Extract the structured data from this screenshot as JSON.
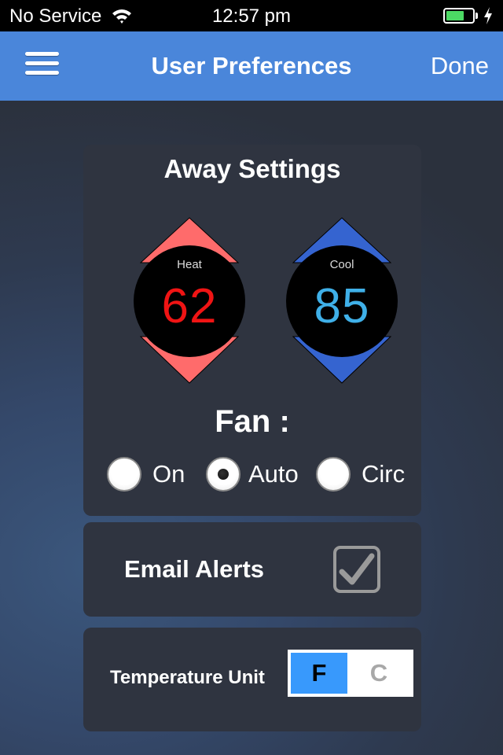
{
  "status_bar": {
    "carrier": "No Service",
    "time": "12:57 pm",
    "battery_level": 0.7,
    "battery_color": "#4cd964",
    "icons": [
      "wifi-icon",
      "battery-icon",
      "charging-bolt-icon"
    ]
  },
  "nav": {
    "menu_icon": "hamburger-menu-icon",
    "title": "User Preferences",
    "done_label": "Done",
    "background": "#4a86da"
  },
  "away_settings": {
    "title": "Away Settings",
    "heat": {
      "label": "Heat",
      "value": "62",
      "color": "#f01414",
      "arrow_color": "#ff6b6b"
    },
    "cool": {
      "label": "Cool",
      "value": "85",
      "color": "#3fb0e8",
      "arrow_color": "#3564d0"
    },
    "fan": {
      "title": "Fan :",
      "options": [
        {
          "label": "On",
          "selected": false
        },
        {
          "label": "Auto",
          "selected": true
        },
        {
          "label": "Circ",
          "selected": false
        }
      ]
    }
  },
  "email_alerts": {
    "label": "Email Alerts",
    "checked": true
  },
  "temperature_unit": {
    "label": "Temperature Unit",
    "options": [
      {
        "label": "F",
        "selected": true
      },
      {
        "label": "C",
        "selected": false
      }
    ],
    "selected_color": "#3899fc"
  }
}
